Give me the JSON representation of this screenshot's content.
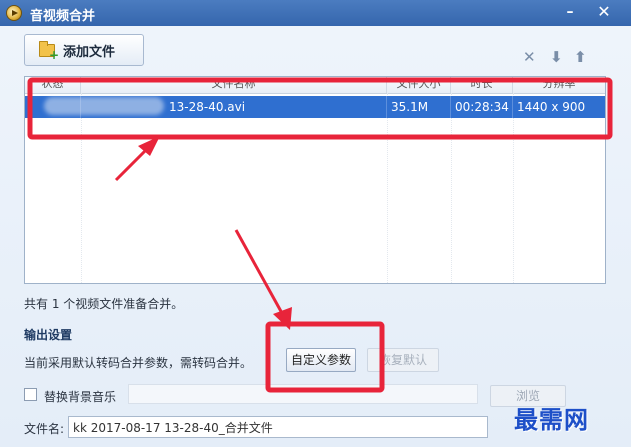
{
  "window": {
    "title": "音视频合并",
    "min_label": "–",
    "close_label": "✕"
  },
  "toolbar": {
    "add_file_label": "添加文件",
    "icons": [
      "folder-add-icon",
      "remove-icon",
      "move-down-icon",
      "move-up-icon"
    ],
    "remove_glyph": "✕",
    "down_glyph": "⬇",
    "up_glyph": "⬆"
  },
  "file_list": {
    "columns": [
      "状态",
      "文件名称",
      "文件大小",
      "时长",
      "分辨率"
    ],
    "rows": [
      {
        "status": "",
        "name": "13-28-40.avi",
        "size": "35.1M",
        "duration": "00:28:34",
        "resolution": "1440 x 900"
      }
    ]
  },
  "summary": {
    "count_text": "共有 1 个视频文件准备合并。"
  },
  "output_settings": {
    "title": "输出设置",
    "param_text": "当前采用默认转码合并参数，需转码合并。",
    "custom_button": "自定义参数",
    "restore_button": "恢复默认",
    "bgm_label": "替换背景音乐",
    "browse_button": "浏览",
    "filename_label": "文件名:",
    "filename_value": "kk 2017-08-17 13-28-40_合并文件"
  },
  "watermark": {
    "text": "最需网"
  },
  "colors": {
    "titlebar": "#3a6cb3",
    "selection": "#2f6fd0",
    "annotation_red": "#e8243a"
  }
}
